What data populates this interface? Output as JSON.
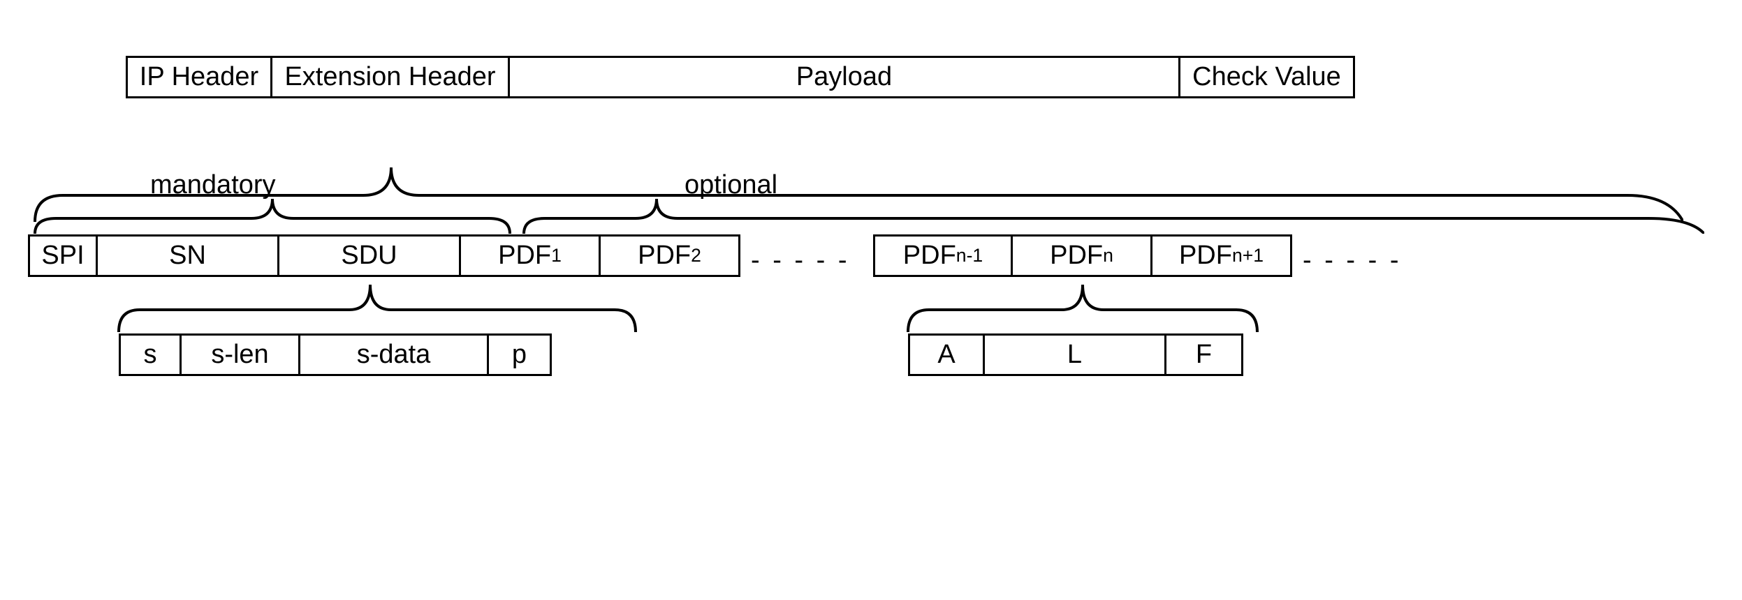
{
  "row1": {
    "ip_header": "IP Header",
    "ext_header": "Extension Header",
    "payload": "Payload",
    "check_value": "Check Value"
  },
  "labels": {
    "mandatory": "mandatory",
    "optional": "optional"
  },
  "row2": {
    "spi": "SPI",
    "sn": "SN",
    "sdu": "SDU",
    "pdf1_prefix": "PDF",
    "pdf1_sub": "1",
    "pdf2_prefix": "PDF",
    "pdf2_sub": "2"
  },
  "row2b": {
    "pdfn1_prefix": "PDF",
    "pdfn1_sub": "n-1",
    "pdfn_prefix": "PDF",
    "pdfn_sub": "n",
    "pdfnp1_prefix": "PDF",
    "pdfnp1_sub": "n+1"
  },
  "row3": {
    "s": "s",
    "slen": "s-len",
    "sdata": "s-data",
    "p": "p"
  },
  "row4": {
    "a": "A",
    "l": "L",
    "f": "F"
  },
  "dashes": "- - - - -"
}
